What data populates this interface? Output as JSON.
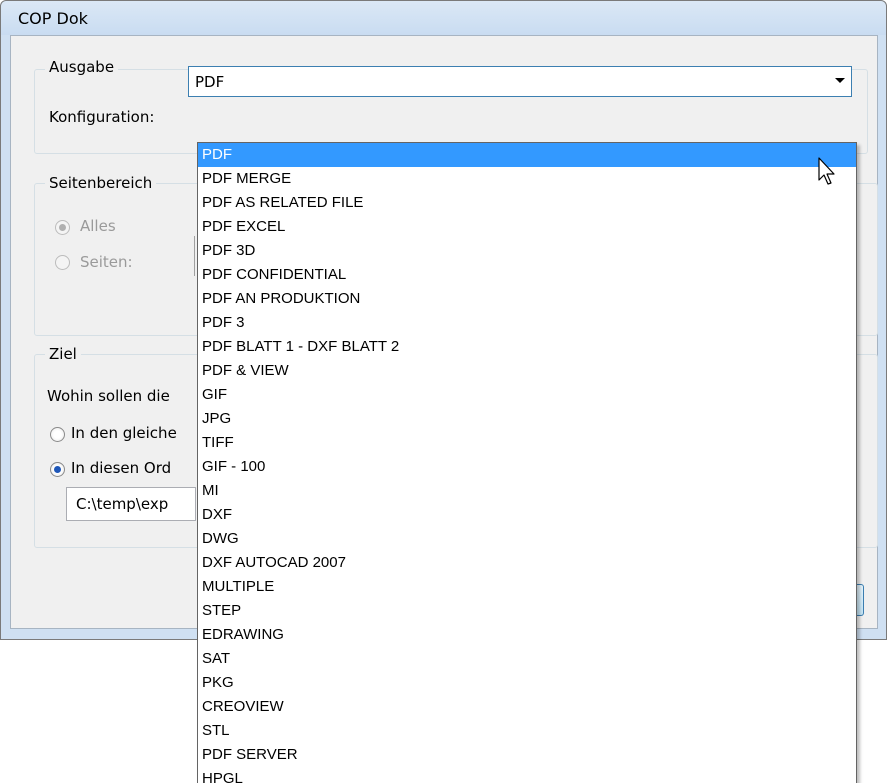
{
  "window": {
    "title": "COP Dok"
  },
  "ausgabe": {
    "group_label": "Ausgabe",
    "config_label": "Konfiguration:",
    "config_value": "PDF"
  },
  "seitenbereich": {
    "group_label": "Seitenbereich",
    "option_all": "Alles",
    "option_pages": "Seiten:"
  },
  "ziel": {
    "group_label": "Ziel",
    "question": "Wohin sollen die",
    "option_same": "In den gleiche",
    "option_folder": "In diesen Ord",
    "path_value": "C:\\temp\\exp"
  },
  "dropdown": {
    "selected_index": 0,
    "items": [
      "PDF",
      "PDF MERGE",
      "PDF AS RELATED FILE",
      "PDF EXCEL",
      "PDF 3D",
      "PDF CONFIDENTIAL",
      "PDF AN PRODUKTION",
      "PDF 3",
      "PDF BLATT 1 - DXF BLATT 2",
      "PDF & VIEW",
      "GIF",
      "JPG",
      "TIFF",
      "GIF - 100",
      "MI",
      "DXF",
      "DWG",
      "DXF AUTOCAD 2007",
      "MULTIPLE",
      "STEP",
      "EDRAWING",
      "SAT",
      "PKG",
      "CREOVIEW",
      "STL",
      "PDF SERVER",
      "HPGL"
    ]
  },
  "colors": {
    "selection": "#3399ff",
    "title_bar": "#cfe0f2",
    "dialog_bg": "#f0f0f0"
  }
}
